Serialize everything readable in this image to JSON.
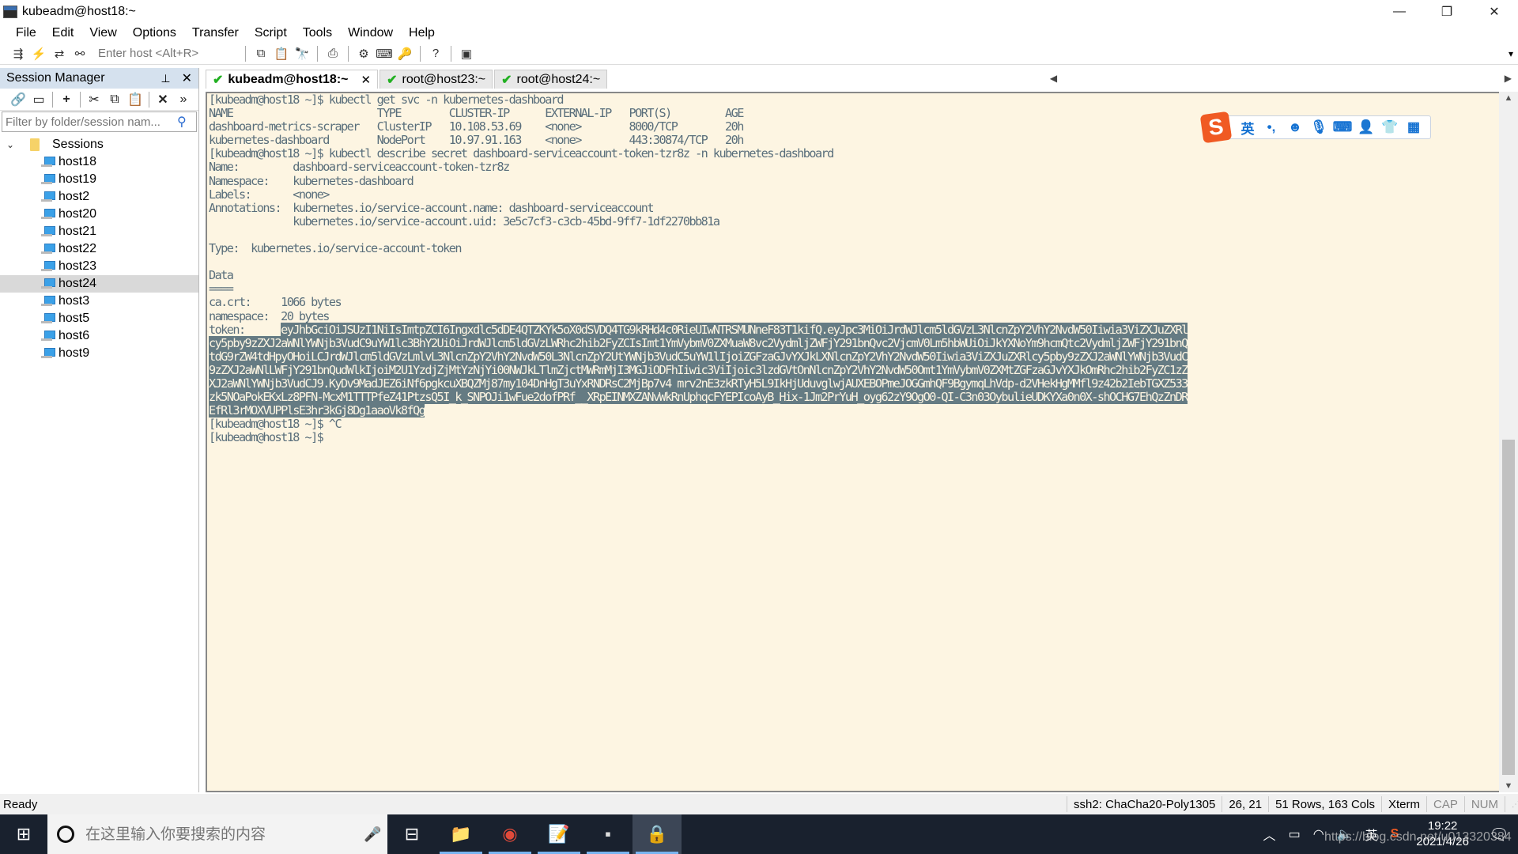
{
  "window": {
    "title": "kubeadm@host18:~",
    "controls": {
      "minimize": "—",
      "restore": "❐",
      "close": "✕"
    }
  },
  "menu": [
    "File",
    "Edit",
    "View",
    "Options",
    "Transfer",
    "Script",
    "Tools",
    "Window",
    "Help"
  ],
  "toolbar": {
    "host_placeholder": "Enter host <Alt+R>",
    "icons": [
      "connect-bar-icon",
      "quick-connect-icon",
      "reconnect-icon",
      "disconnect-icon",
      "copy-icon",
      "paste-icon",
      "find-icon",
      "print-icon",
      "settings-icon",
      "keymap-icon",
      "key-icon",
      "help-icon",
      "sftp-icon"
    ]
  },
  "session_manager": {
    "title": "Session Manager",
    "filter_placeholder": "Filter by folder/session nam...",
    "root": "Sessions",
    "sessions": [
      "host18",
      "host19",
      "host2",
      "host20",
      "host21",
      "host22",
      "host23",
      "host24",
      "host3",
      "host5",
      "host6",
      "host9"
    ],
    "selected": "host24"
  },
  "tabs": [
    {
      "label": "kubeadm@host18:~",
      "active": true,
      "connected": true
    },
    {
      "label": "root@host23:~",
      "active": false,
      "connected": true
    },
    {
      "label": "root@host24:~",
      "active": false,
      "connected": true
    }
  ],
  "terminal": {
    "lines_before_token": [
      "[kubeadm@host18 ~]$ kubectl get svc -n kubernetes-dashboard",
      "NAME                        TYPE        CLUSTER-IP      EXTERNAL-IP   PORT(S)         AGE",
      "dashboard-metrics-scraper   ClusterIP   10.108.53.69    <none>        8000/TCP        20h",
      "kubernetes-dashboard        NodePort    10.97.91.163    <none>        443:30874/TCP   20h",
      "[kubeadm@host18 ~]$ kubectl describe secret dashboard-serviceaccount-token-tzr8z -n kubernetes-dashboard",
      "Name:         dashboard-serviceaccount-token-tzr8z",
      "Namespace:    kubernetes-dashboard",
      "Labels:       <none>",
      "Annotations:  kubernetes.io/service-account.name: dashboard-serviceaccount",
      "              kubernetes.io/service-account.uid: 3e5c7cf3-c3cb-45bd-9ff7-1df2270bb81a",
      "",
      "Type:  kubernetes.io/service-account-token",
      "",
      "Data",
      "====",
      "ca.crt:     1066 bytes",
      "namespace:  20 bytes"
    ],
    "token_label": "token:      ",
    "token_lines": [
      "eyJhbGciOiJSUzI1NiIsImtpZCI6Ingxdlc5dDE4QTZKYk5oX0dSVDQ4TG9kRHd4c0RieUIwNTRSMUNneF83T1kifQ.eyJpc3MiOiJrdWJlcm5ldGVzL3NlcnZpY2VhY2NvdW50Iiwia3ViZXJuZXRl",
      "cy5pby9zZXJ2aWNlYWNjb3VudC9uYW1lc3BhY2UiOiJrdWJlcm5ldGVzLWRhc2hib2FyZCIsImt1YmVybmV0ZXMuaW8vc2VydmljZWFjY291bnQvc2VjcmV0Lm5hbWUiOiJkYXNoYm9hcmQtc2VydmljZWFjY291bnQ",
      "tdG9rZW4tdHpyOHoiLCJrdWJlcm5ldGVzLmlvL3NlcnZpY2VhY2NvdW50L3NlcnZpY2UtYWNjb3VudC5uYW1lIjoiZGFzaGJvYXJkLXNlcnZpY2VhY2NvdW50Iiwia3ViZXJuZXRlcy5pby9zZXJ2aWNlYWNjb3VudC",
      "9zZXJ2aWNlLWFjY291bnQudWlkIjoiM2U1YzdjZjMtYzNjYi00NWJkLTlmZjctMWRmMjI3MGJiODFhIiwic3ViIjoic3lzdGVtOnNlcnZpY2VhY2NvdW50Omt1YmVybmV0ZXMtZGFzaGJvYXJkOmRhc2hib2FyZC1zZ",
      "XJ2aWNlYWNjb3VudCJ9.KyDv9MadJEZ6iNf6pgkcuXBQZMj87my104DnHgT3uYxRNDRsC2MjBp7v4_mrv2nE3zkRTyH5L9IkHjUduvglwjAUXEBOPmeJOGGmhQF9BgymqLhVdp-d2VHekHgMMfl9z42b2IebTGXZ533",
      "zk5NOaPokEKxLz8PFN-McxM1TTTPfeZ41PtzsQ5I_k_SNPOJi1wFue2dofPRf__XRpEINMXZANvWkRnUphqcFYEPIcoAyB_Hix-1Jm2PrYuH_oyg62zY9OgO0-QI-C3n03OybulieUDKYXa0n0X-shOCHG7EhQzZnDR",
      "EfRl3rMOXVUPPlsE3hr3kGj8Dg1aaoVk8fQg"
    ],
    "lines_after_token": [
      "[kubeadm@host18 ~]$ ^C",
      "[kubeadm@host18 ~]$ "
    ]
  },
  "ime_toolbar": {
    "logo": "S",
    "items": [
      {
        "name": "ime-lang-icon",
        "glyph": "英"
      },
      {
        "name": "ime-punct-icon",
        "glyph": "•,"
      },
      {
        "name": "ime-emoji-icon",
        "glyph": "☻"
      },
      {
        "name": "ime-voice-icon",
        "glyph": "🎙"
      },
      {
        "name": "ime-keyboard-icon",
        "glyph": "⌨"
      },
      {
        "name": "ime-user-icon",
        "glyph": "👤"
      },
      {
        "name": "ime-skin-icon",
        "glyph": "👕"
      },
      {
        "name": "ime-apps-icon",
        "glyph": "▦"
      }
    ]
  },
  "statusbar": {
    "status": "Ready",
    "cipher": "ssh2: ChaCha20-Poly1305",
    "cursor": "26,  21",
    "size": "51 Rows, 163 Cols",
    "term_type": "Xterm",
    "cap": "CAP",
    "num": "NUM"
  },
  "taskbar": {
    "search_placeholder": "在这里输入你要搜索的内容",
    "apps": [
      "task-view-icon",
      "file-explorer-icon",
      "chrome-icon",
      "notepad-plus-icon",
      "terminal-icon",
      "securecrt-icon"
    ],
    "tray": {
      "ime": "英",
      "time": "19:22",
      "date": "2021/4/26",
      "notification_count": "1"
    },
    "watermark": "https://blog.csdn.net/u013320384"
  }
}
